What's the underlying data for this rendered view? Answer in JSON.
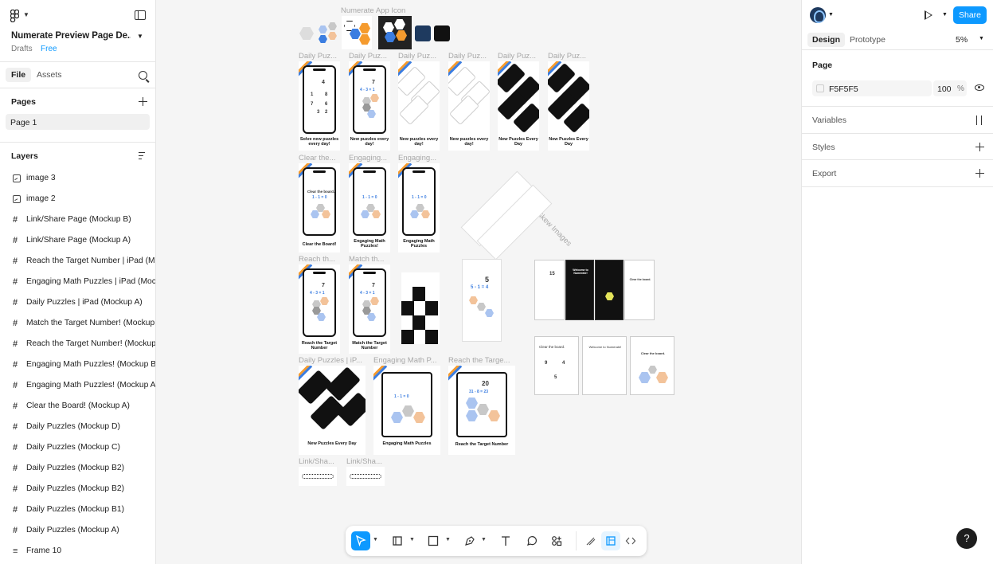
{
  "file": {
    "name": "Numerate Preview Page De...",
    "location": "Drafts",
    "plan": "Free"
  },
  "left_panel": {
    "tabs": {
      "file": "File",
      "assets": "Assets"
    },
    "pages_title": "Pages",
    "pages": [
      "Page 1"
    ],
    "layers_title": "Layers",
    "layers": [
      {
        "name": "image 3",
        "icon": "image-icon"
      },
      {
        "name": "image 2",
        "icon": "image-icon"
      },
      {
        "name": "Link/Share Page (Mockup B)",
        "icon": "frame-icon"
      },
      {
        "name": "Link/Share Page (Mockup A)",
        "icon": "frame-icon"
      },
      {
        "name": "Reach the Target Number | iPad (Moc",
        "icon": "frame-icon"
      },
      {
        "name": "Engaging Math Puzzles | iPad (Mocku",
        "icon": "frame-icon"
      },
      {
        "name": "Daily Puzzles | iPad (Mockup A)",
        "icon": "frame-icon"
      },
      {
        "name": "Match the Target Number! (Mockup A",
        "icon": "frame-icon"
      },
      {
        "name": "Reach the Target Number! (Mockup A",
        "icon": "frame-icon"
      },
      {
        "name": "Engaging Math Puzzles! (Mockup B)",
        "icon": "frame-icon"
      },
      {
        "name": "Engaging Math Puzzles! (Mockup A)",
        "icon": "frame-icon"
      },
      {
        "name": "Clear the Board! (Mockup A)",
        "icon": "frame-icon"
      },
      {
        "name": "Daily Puzzles (Mockup D)",
        "icon": "frame-icon"
      },
      {
        "name": "Daily Puzzles (Mockup C)",
        "icon": "frame-icon"
      },
      {
        "name": "Daily Puzzles (Mockup B2)",
        "icon": "frame-icon"
      },
      {
        "name": "Daily Puzzles (Mockup B2)",
        "icon": "frame-icon"
      },
      {
        "name": "Daily Puzzles (Mockup B1)",
        "icon": "frame-icon"
      },
      {
        "name": "Daily Puzzles (Mockup A)",
        "icon": "frame-icon"
      },
      {
        "name": "Frame 10",
        "icon": "section-icon"
      }
    ]
  },
  "canvas": {
    "labels": {
      "app_icon": "Numerate App Icon",
      "dp1": "Daily Puz...",
      "dp2": "Daily Puz...",
      "dp3": "Daily Puz...",
      "dp4": "Daily Puz...",
      "dp5": "Daily Puz...",
      "dp6": "Daily Puz...",
      "clear": "Clear the...",
      "eng1": "Engaging...",
      "eng2": "Engaging...",
      "reach": "Reach th...",
      "match": "Match th...",
      "diag": "Diagonal Skew Images",
      "ipad1": "Daily Puzzles | iP...",
      "ipad2": "Engaging Math P...",
      "ipad3": "Reach the Targe...",
      "link1": "Link/Sha...",
      "link2": "Link/Sha..."
    },
    "captions": {
      "dp1": "Solve new puzzles every day!",
      "dp2": "New puzzles every day!",
      "dp3": "New puzzles every day!",
      "dp4": "New puzzles every day!",
      "dp5": "New Puzzles Every Day",
      "dp6": "New Puzzles Every Day",
      "clear": "Clear the Board!",
      "eng1": "Engaging Math Puzzles!",
      "eng2": "Engaging Math Puzzles",
      "reach": "Reach the Target Number",
      "match": "Match the Target Number",
      "ipad1": "New Puzzles Every Day",
      "ipad2": "Engaging Math Puzzles",
      "ipad3": "Reach the Target Number"
    },
    "mock_text": {
      "four": "4",
      "seven": "7",
      "five": "5",
      "fifteen": "15",
      "twenty": "20",
      "eq_431": "4 - 3 = 1",
      "eq_110": "1 - 1 = 0",
      "eq_514": "5 - 1 = 4",
      "eq_31823": "31 - 8 = 23",
      "clear_board": "Clear the board.",
      "welcome": "Welcome to Numerate!"
    }
  },
  "toolbar": {
    "tools": [
      "move-tool",
      "frame-tool",
      "shape-tool",
      "pen-tool",
      "text-tool",
      "comment-tool",
      "actions-tool",
      "draw-mode",
      "design-mode",
      "dev-mode"
    ]
  },
  "right_panel": {
    "share": "Share",
    "tabs": {
      "design": "Design",
      "prototype": "Prototype"
    },
    "zoom": "5%",
    "page_section": "Page",
    "page_color": "F5F5F5",
    "page_opacity": "100",
    "opacity_unit": "%",
    "variables": "Variables",
    "styles": "Styles",
    "export": "Export",
    "help": "?"
  },
  "colors": {
    "accent": "#0d99ff",
    "hex_blue": "#aac4f0",
    "hex_orange": "#f3c39a",
    "stripe_orange": "#f59b2e",
    "stripe_blue": "#3b7de0"
  }
}
